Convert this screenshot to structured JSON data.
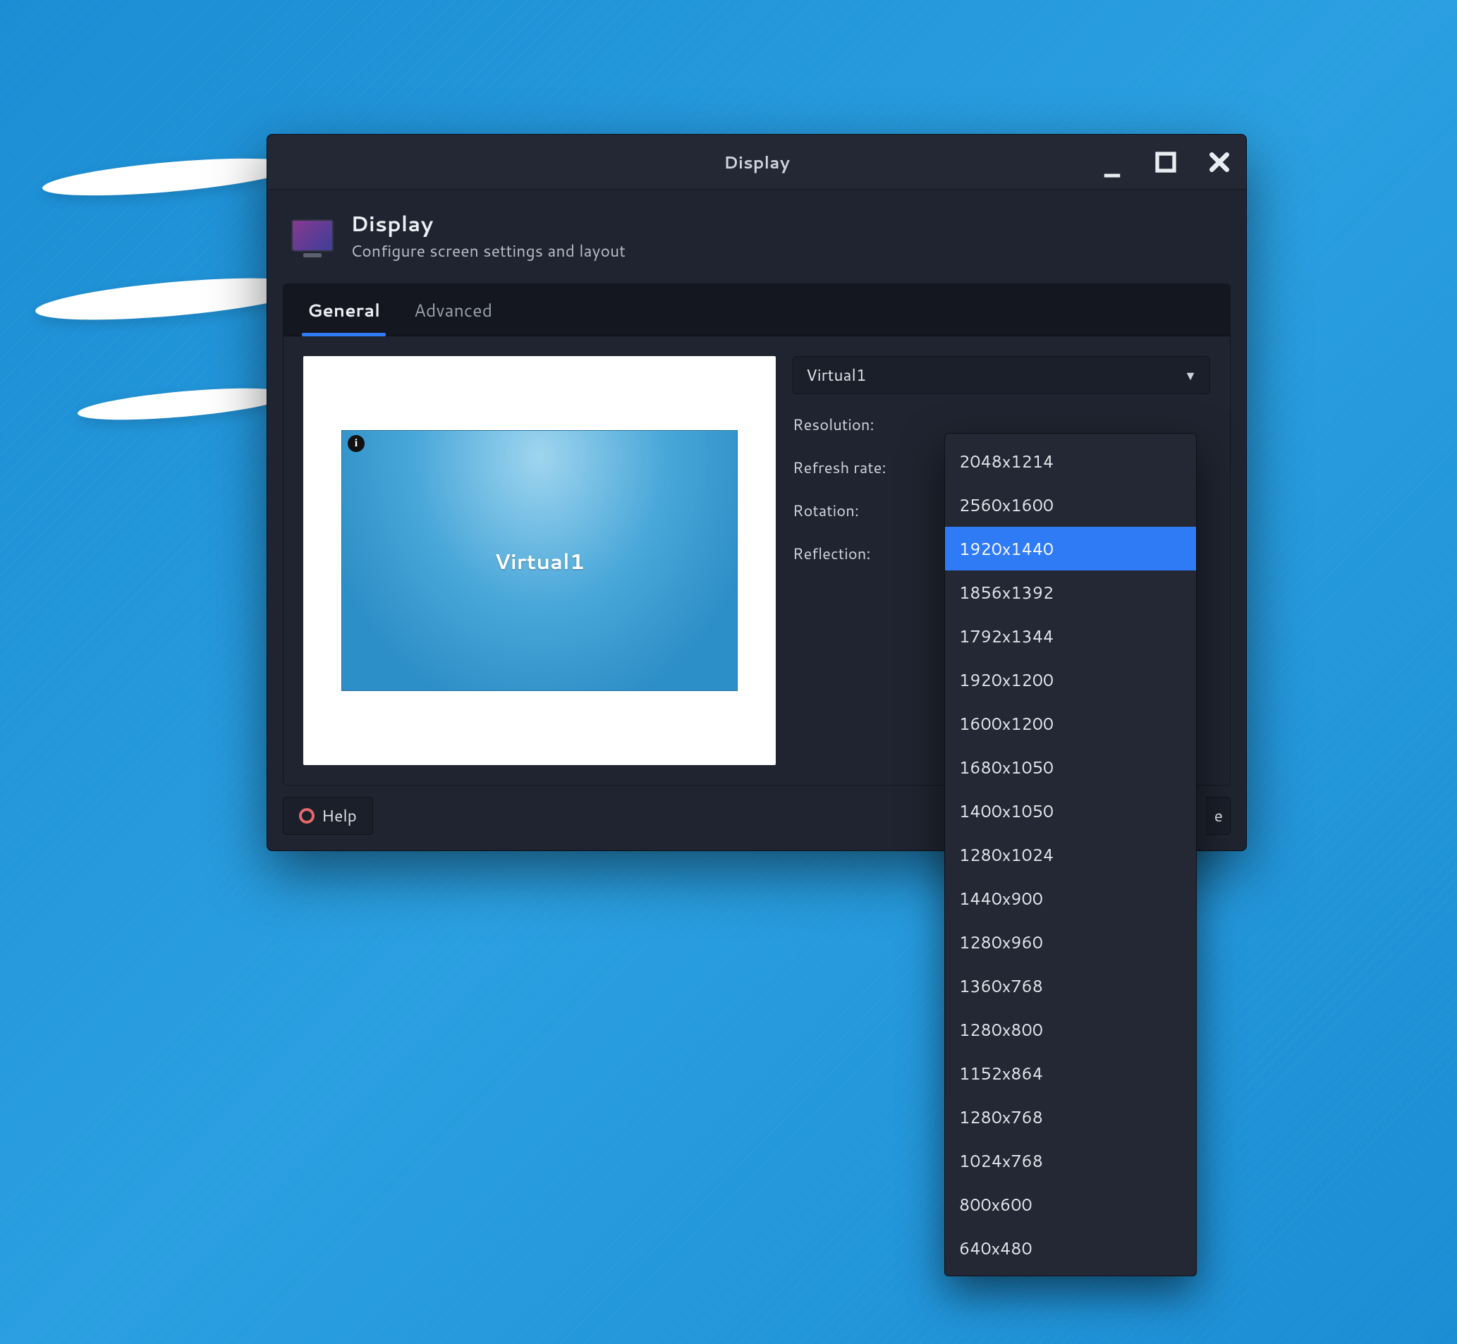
{
  "window": {
    "titlebar": "Display",
    "controls": {
      "minimize": "minimize-icon",
      "maximize": "maximize-icon",
      "close": "close-icon"
    }
  },
  "header": {
    "title": "Display",
    "subtitle": "Configure screen settings and layout"
  },
  "tabs": [
    {
      "label": "General",
      "active": true
    },
    {
      "label": "Advanced",
      "active": false
    }
  ],
  "preview": {
    "screen_label": "Virtual1",
    "info_badge": "i"
  },
  "settings": {
    "output_selector": {
      "value": "Virtual1"
    },
    "rows": {
      "resolution_label": "Resolution:",
      "refresh_label": "Refresh rate:",
      "rotation_label": "Rotation:",
      "reflection_label": "Reflection:"
    }
  },
  "resolution_dropdown": {
    "highlighted_index": 2,
    "options": [
      "2048x1214",
      "2560x1600",
      "1920x1440",
      "1856x1392",
      "1792x1344",
      "1920x1200",
      "1600x1200",
      "1680x1050",
      "1400x1050",
      "1280x1024",
      "1440x900",
      "1280x960",
      "1360x768",
      "1280x800",
      "1152x864",
      "1280x768",
      "1024x768",
      "800x600",
      "640x480"
    ]
  },
  "footer": {
    "help_label": "Help",
    "right_peek": "e"
  }
}
